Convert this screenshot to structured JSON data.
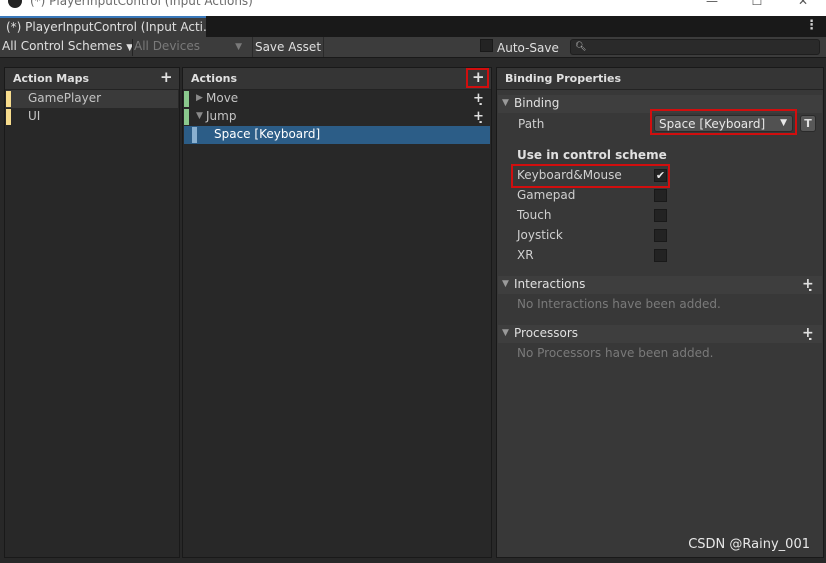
{
  "window": {
    "title": "(*) PlayerInputControl (Input Actions)",
    "controls": [
      "—",
      "☐",
      "✕"
    ]
  },
  "tab": {
    "label": "(*) PlayerInputControl (Input Acti..."
  },
  "toolbar": {
    "control_schemes": "All Control Schemes",
    "devices": "All Devices",
    "save_asset": "Save Asset",
    "auto_save": "Auto-Save",
    "search_value": ""
  },
  "action_maps": {
    "header": "Action Maps",
    "items": [
      {
        "label": "GamePlayer",
        "color": "#f7dc8d",
        "selected": true
      },
      {
        "label": "UI",
        "color": "#f7dc8d",
        "selected": false
      }
    ]
  },
  "actions": {
    "header": "Actions",
    "items": [
      {
        "label": "Move",
        "expanded": false,
        "color": "#8ac98d"
      },
      {
        "label": "Jump",
        "expanded": true,
        "color": "#8ac98d"
      }
    ],
    "binding": {
      "label": "Space [Keyboard]",
      "color": "#8ab0d0"
    }
  },
  "binding_properties": {
    "header": "Binding Properties",
    "binding_section": "Binding",
    "path_label": "Path",
    "path_value": "Space [Keyboard]",
    "t_button": "T",
    "scheme_heading": "Use in control scheme",
    "schemes": [
      {
        "label": "Keyboard&Mouse",
        "checked": true
      },
      {
        "label": "Gamepad",
        "checked": false
      },
      {
        "label": "Touch",
        "checked": false
      },
      {
        "label": "Joystick",
        "checked": false
      },
      {
        "label": "XR",
        "checked": false
      }
    ],
    "interactions_section": "Interactions",
    "interactions_empty": "No Interactions have been added.",
    "processors_section": "Processors",
    "processors_empty": "No Processors have been added."
  },
  "watermark": "CSDN @Rainy_001",
  "colors": {
    "accent": "#2c5d87",
    "annotation": "#d10e0e",
    "action_map_color": "#f7dc8d",
    "action_color": "#8ac98d"
  }
}
